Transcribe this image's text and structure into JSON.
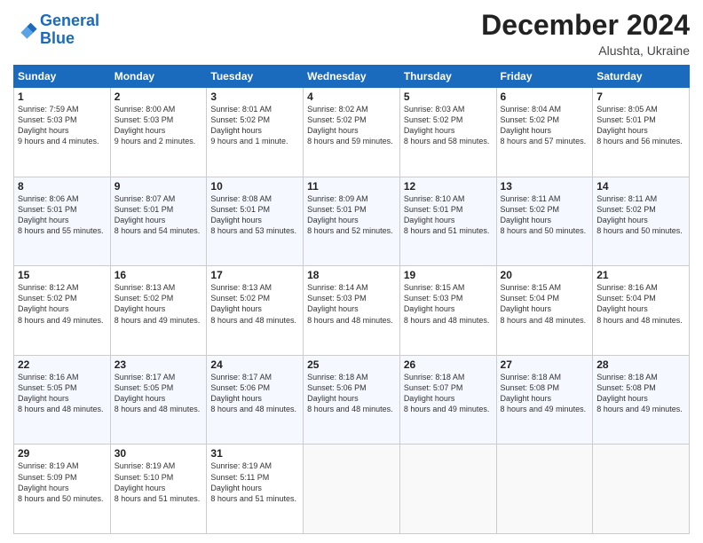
{
  "header": {
    "logo_line1": "General",
    "logo_line2": "Blue",
    "month_year": "December 2024",
    "location": "Alushta, Ukraine"
  },
  "weekdays": [
    "Sunday",
    "Monday",
    "Tuesday",
    "Wednesday",
    "Thursday",
    "Friday",
    "Saturday"
  ],
  "weeks": [
    [
      {
        "day": 1,
        "sunrise": "7:59 AM",
        "sunset": "5:03 PM",
        "daylight": "9 hours and 4 minutes."
      },
      {
        "day": 2,
        "sunrise": "8:00 AM",
        "sunset": "5:03 PM",
        "daylight": "9 hours and 2 minutes."
      },
      {
        "day": 3,
        "sunrise": "8:01 AM",
        "sunset": "5:02 PM",
        "daylight": "9 hours and 1 minute."
      },
      {
        "day": 4,
        "sunrise": "8:02 AM",
        "sunset": "5:02 PM",
        "daylight": "8 hours and 59 minutes."
      },
      {
        "day": 5,
        "sunrise": "8:03 AM",
        "sunset": "5:02 PM",
        "daylight": "8 hours and 58 minutes."
      },
      {
        "day": 6,
        "sunrise": "8:04 AM",
        "sunset": "5:02 PM",
        "daylight": "8 hours and 57 minutes."
      },
      {
        "day": 7,
        "sunrise": "8:05 AM",
        "sunset": "5:01 PM",
        "daylight": "8 hours and 56 minutes."
      }
    ],
    [
      {
        "day": 8,
        "sunrise": "8:06 AM",
        "sunset": "5:01 PM",
        "daylight": "8 hours and 55 minutes."
      },
      {
        "day": 9,
        "sunrise": "8:07 AM",
        "sunset": "5:01 PM",
        "daylight": "8 hours and 54 minutes."
      },
      {
        "day": 10,
        "sunrise": "8:08 AM",
        "sunset": "5:01 PM",
        "daylight": "8 hours and 53 minutes."
      },
      {
        "day": 11,
        "sunrise": "8:09 AM",
        "sunset": "5:01 PM",
        "daylight": "8 hours and 52 minutes."
      },
      {
        "day": 12,
        "sunrise": "8:10 AM",
        "sunset": "5:01 PM",
        "daylight": "8 hours and 51 minutes."
      },
      {
        "day": 13,
        "sunrise": "8:11 AM",
        "sunset": "5:02 PM",
        "daylight": "8 hours and 50 minutes."
      },
      {
        "day": 14,
        "sunrise": "8:11 AM",
        "sunset": "5:02 PM",
        "daylight": "8 hours and 50 minutes."
      }
    ],
    [
      {
        "day": 15,
        "sunrise": "8:12 AM",
        "sunset": "5:02 PM",
        "daylight": "8 hours and 49 minutes."
      },
      {
        "day": 16,
        "sunrise": "8:13 AM",
        "sunset": "5:02 PM",
        "daylight": "8 hours and 49 minutes."
      },
      {
        "day": 17,
        "sunrise": "8:13 AM",
        "sunset": "5:02 PM",
        "daylight": "8 hours and 48 minutes."
      },
      {
        "day": 18,
        "sunrise": "8:14 AM",
        "sunset": "5:03 PM",
        "daylight": "8 hours and 48 minutes."
      },
      {
        "day": 19,
        "sunrise": "8:15 AM",
        "sunset": "5:03 PM",
        "daylight": "8 hours and 48 minutes."
      },
      {
        "day": 20,
        "sunrise": "8:15 AM",
        "sunset": "5:04 PM",
        "daylight": "8 hours and 48 minutes."
      },
      {
        "day": 21,
        "sunrise": "8:16 AM",
        "sunset": "5:04 PM",
        "daylight": "8 hours and 48 minutes."
      }
    ],
    [
      {
        "day": 22,
        "sunrise": "8:16 AM",
        "sunset": "5:05 PM",
        "daylight": "8 hours and 48 minutes."
      },
      {
        "day": 23,
        "sunrise": "8:17 AM",
        "sunset": "5:05 PM",
        "daylight": "8 hours and 48 minutes."
      },
      {
        "day": 24,
        "sunrise": "8:17 AM",
        "sunset": "5:06 PM",
        "daylight": "8 hours and 48 minutes."
      },
      {
        "day": 25,
        "sunrise": "8:18 AM",
        "sunset": "5:06 PM",
        "daylight": "8 hours and 48 minutes."
      },
      {
        "day": 26,
        "sunrise": "8:18 AM",
        "sunset": "5:07 PM",
        "daylight": "8 hours and 49 minutes."
      },
      {
        "day": 27,
        "sunrise": "8:18 AM",
        "sunset": "5:08 PM",
        "daylight": "8 hours and 49 minutes."
      },
      {
        "day": 28,
        "sunrise": "8:18 AM",
        "sunset": "5:08 PM",
        "daylight": "8 hours and 49 minutes."
      }
    ],
    [
      {
        "day": 29,
        "sunrise": "8:19 AM",
        "sunset": "5:09 PM",
        "daylight": "8 hours and 50 minutes."
      },
      {
        "day": 30,
        "sunrise": "8:19 AM",
        "sunset": "5:10 PM",
        "daylight": "8 hours and 51 minutes."
      },
      {
        "day": 31,
        "sunrise": "8:19 AM",
        "sunset": "5:11 PM",
        "daylight": "8 hours and 51 minutes."
      },
      null,
      null,
      null,
      null
    ]
  ]
}
